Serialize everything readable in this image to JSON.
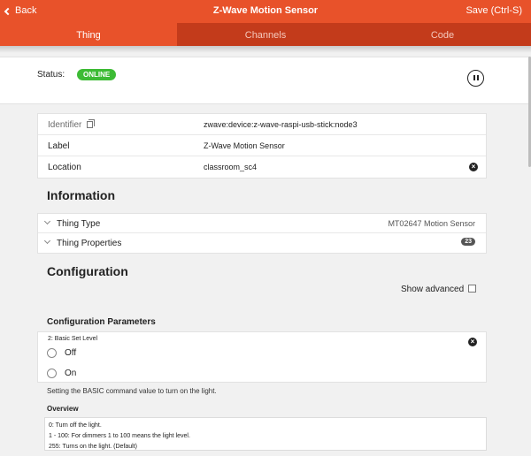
{
  "nav": {
    "back_label": "Back",
    "title": "Z-Wave Motion Sensor",
    "save_label": "Save (Ctrl-S)"
  },
  "tabs": [
    {
      "label": "Thing",
      "active": true
    },
    {
      "label": "Channels",
      "active": false
    },
    {
      "label": "Code",
      "active": false
    }
  ],
  "status": {
    "label": "Status:",
    "badge": "ONLINE",
    "badge_color": "#3dbb35"
  },
  "details": {
    "identifier_label": "Identifier",
    "identifier_value": "zwave:device:z-wave-raspi-usb-stick:node3",
    "label_label": "Label",
    "label_value": "Z-Wave Motion Sensor",
    "location_label": "Location",
    "location_value": "classroom_sc4"
  },
  "information": {
    "title": "Information",
    "thing_type_label": "Thing Type",
    "thing_type_value": "MT02647 Motion Sensor",
    "thing_properties_label": "Thing Properties",
    "thing_properties_count": "23"
  },
  "configuration": {
    "title": "Configuration",
    "show_advanced_label": "Show advanced",
    "parameters_title": "Configuration Parameters",
    "param": {
      "label": "2: Basic Set Level",
      "options": [
        "Off",
        "On"
      ],
      "description": "Setting the BASIC command value to turn on the light."
    },
    "overview_title": "Overview",
    "overview_lines": [
      "0: Turn off the light.",
      "1 - 100: For dimmers 1 to 100 means the light level.",
      "255: Turns on the light. (Default)"
    ]
  },
  "colors": {
    "accent": "#e8522a",
    "tab_bar": "#c33b1b"
  },
  "icons": [
    "chevron-left-icon",
    "copy-icon",
    "clear-icon",
    "pause-icon",
    "chevron-down-icon"
  ]
}
